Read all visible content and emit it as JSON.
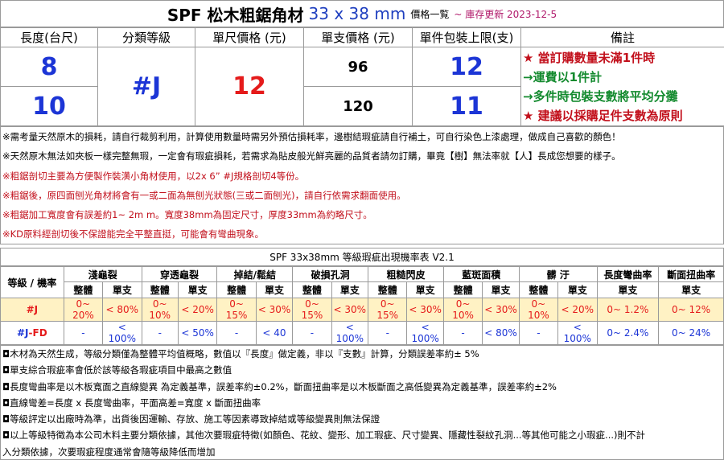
{
  "title": {
    "main": "SPF 松木粗鋸角材",
    "size": "33 x 38 mm",
    "suffix": "價格一覧",
    "updated": "~ 庫存更新 2023-12-5"
  },
  "top_table": {
    "headers": [
      "長度(台尺)",
      "分類等級",
      "單尺價格 (元)",
      "單支價格 (元)",
      "單件包裝上限(支)",
      "備註"
    ],
    "grade": "#J",
    "unit_price": "12",
    "rows": [
      {
        "length": "8",
        "price": "96",
        "pack": "12"
      },
      {
        "length": "10",
        "price": "120",
        "pack": "11"
      }
    ],
    "remarks": [
      "★ 當訂購數量未滿1件時",
      "→運費以1件計",
      "→多件時包裝支數將平均分攤",
      "★ 建議以採購足件支數為原則"
    ]
  },
  "notes": [
    "※需考量天然原木的損耗，請自行裁剪利用，計算使用數量時需另外預估損耗率，邊樹結瑕疵請自行補土，可自行染色上漆處理，做成自己喜歡的顏色！",
    "※天然原木無法如夾板一樣完整無瑕，一定會有瑕疵損耗，若需求為貼皮般光鮮亮麗的品質者請勿訂購，畢竟【樹】無法率就【人】長成您想要的樣子。",
    "※粗鋸剖切主要為方便製作裝潢小角材使用，以2x 6”  #J規格剖切4等份。",
    "※粗鋸後，原四面刨光角材將會有一或二面為無刨光狀態(三或二面刨光)，請自行依需求翻面使用。",
    "※粗鋸加工寬度會有誤差約1~ 2m m。寬度38mm為固定尺寸，厚度33mm為約略尺寸。",
    "※KD原料經剖切後不保證能完全平整直挺，可能會有彎曲現象。"
  ],
  "defect_table": {
    "title": "SPF 33x38mm 等級瑕疵出現機率表 V2.1",
    "corner": "等級 / 機率",
    "categories": [
      "淺龜裂",
      "穿透龜裂",
      "掉結/鬆結",
      "破損孔洞",
      "粗糙閃皮",
      "藍斑面積",
      "髒 汙",
      "長度彎曲率",
      "斷面扭曲率"
    ],
    "sub_whole": "整體",
    "sub_single": "單支",
    "rows": [
      {
        "grade": "#J",
        "values": [
          "0~ 20%",
          "< 80%",
          "0~ 10%",
          "< 20%",
          "0~ 15%",
          "< 30%",
          "0~ 15%",
          "< 30%",
          "0~ 15%",
          "< 30%",
          "0~ 10%",
          "< 30%",
          "0~ 10%",
          "< 20%",
          "0~ 1.2%",
          "0~ 12%"
        ]
      },
      {
        "grade_a": "#J",
        "grade_b": "-FD",
        "values": [
          "-",
          "< 100%",
          "-",
          "< 50%",
          "-",
          "< 40",
          "-",
          "< 100%",
          "-",
          "< 100%",
          "-",
          "< 80%",
          "-",
          "< 100%",
          "0~ 2.4%",
          "0~ 24%"
        ]
      }
    ]
  },
  "footer": [
    "◘木材為天然生成，等級分類僅為整體平均值概略，數值以『長度』做定義，非以『支數』計算，分類誤差率約± 5%",
    "◘單支綜合瑕疵率會低於該等級各瑕疵項目中最高之數值",
    "◘長度彎曲率是以木板寬面之直線變異 為定義基準，誤差率約±0.2%，斷面扭曲率是以木板斷面之高低變異為定義基準，誤差率約±2%",
    "◘直線彎差=長度 x 長度彎曲率，平面高差=寬度 x 斷面扭曲率",
    "◘等級評定以出廠時為準，出貨後因運輸、存放、施工等因素導致掉結或等級變異則無法保證",
    "◘以上等級特徵為本公司木料主要分類依據，其他次要瑕疵特徵(如顏色、花紋、變形、加工瑕疵、尺寸變異、隱藏性裂紋孔洞...等其他可能之小瑕疵...)則不計",
    "入分類依據，次要瑕疵程度通常會隨等級降低而增加"
  ]
}
